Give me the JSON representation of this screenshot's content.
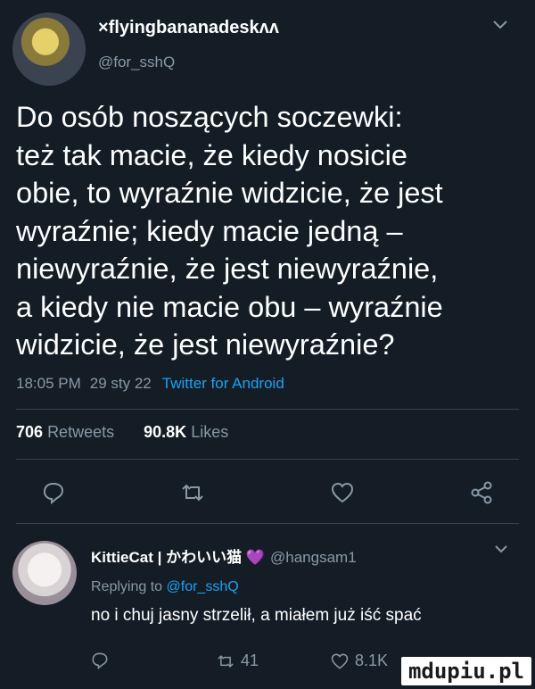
{
  "tweet": {
    "display_name": "×flyingbananadeskʌʌ",
    "handle": "@for_sshQ",
    "text": "Do osób noszących soczewki:\nteż tak macie, że kiedy nosicie\nobie, to wyraźnie widzicie, że jest\nwyraźnie; kiedy macie jedną –\nniewyraźnie, że jest niewyraźnie,\na kiedy nie macie obu – wyraźnie\nwidzicie, że jest niewyraźnie?",
    "time": "18:05 PM",
    "date": "29 sty 22",
    "via": "Twitter for Android",
    "retweets_count": "706",
    "retweets_label": "Retweets",
    "likes_count": "90.8K",
    "likes_label": "Likes"
  },
  "reply": {
    "display_name": "KittieCat | かわいい猫 💜",
    "handle": "@hangsam1",
    "replying_prefix": "Replying to",
    "replying_handle": "@for_sshQ",
    "text": "no i chuj jasny strzelił, a miałem już iść spać",
    "retweets": "41",
    "likes": "8.1K"
  },
  "icons": {
    "reply": "reply-icon",
    "retweet": "retweet-icon",
    "like": "heart-icon",
    "share": "share-icon",
    "menu": "chevron-down-icon"
  },
  "colors": {
    "background": "#141d26",
    "accent": "#1da1f2",
    "muted": "#8899a6",
    "divider": "#38444d"
  },
  "watermark": "mdupiu.pl"
}
